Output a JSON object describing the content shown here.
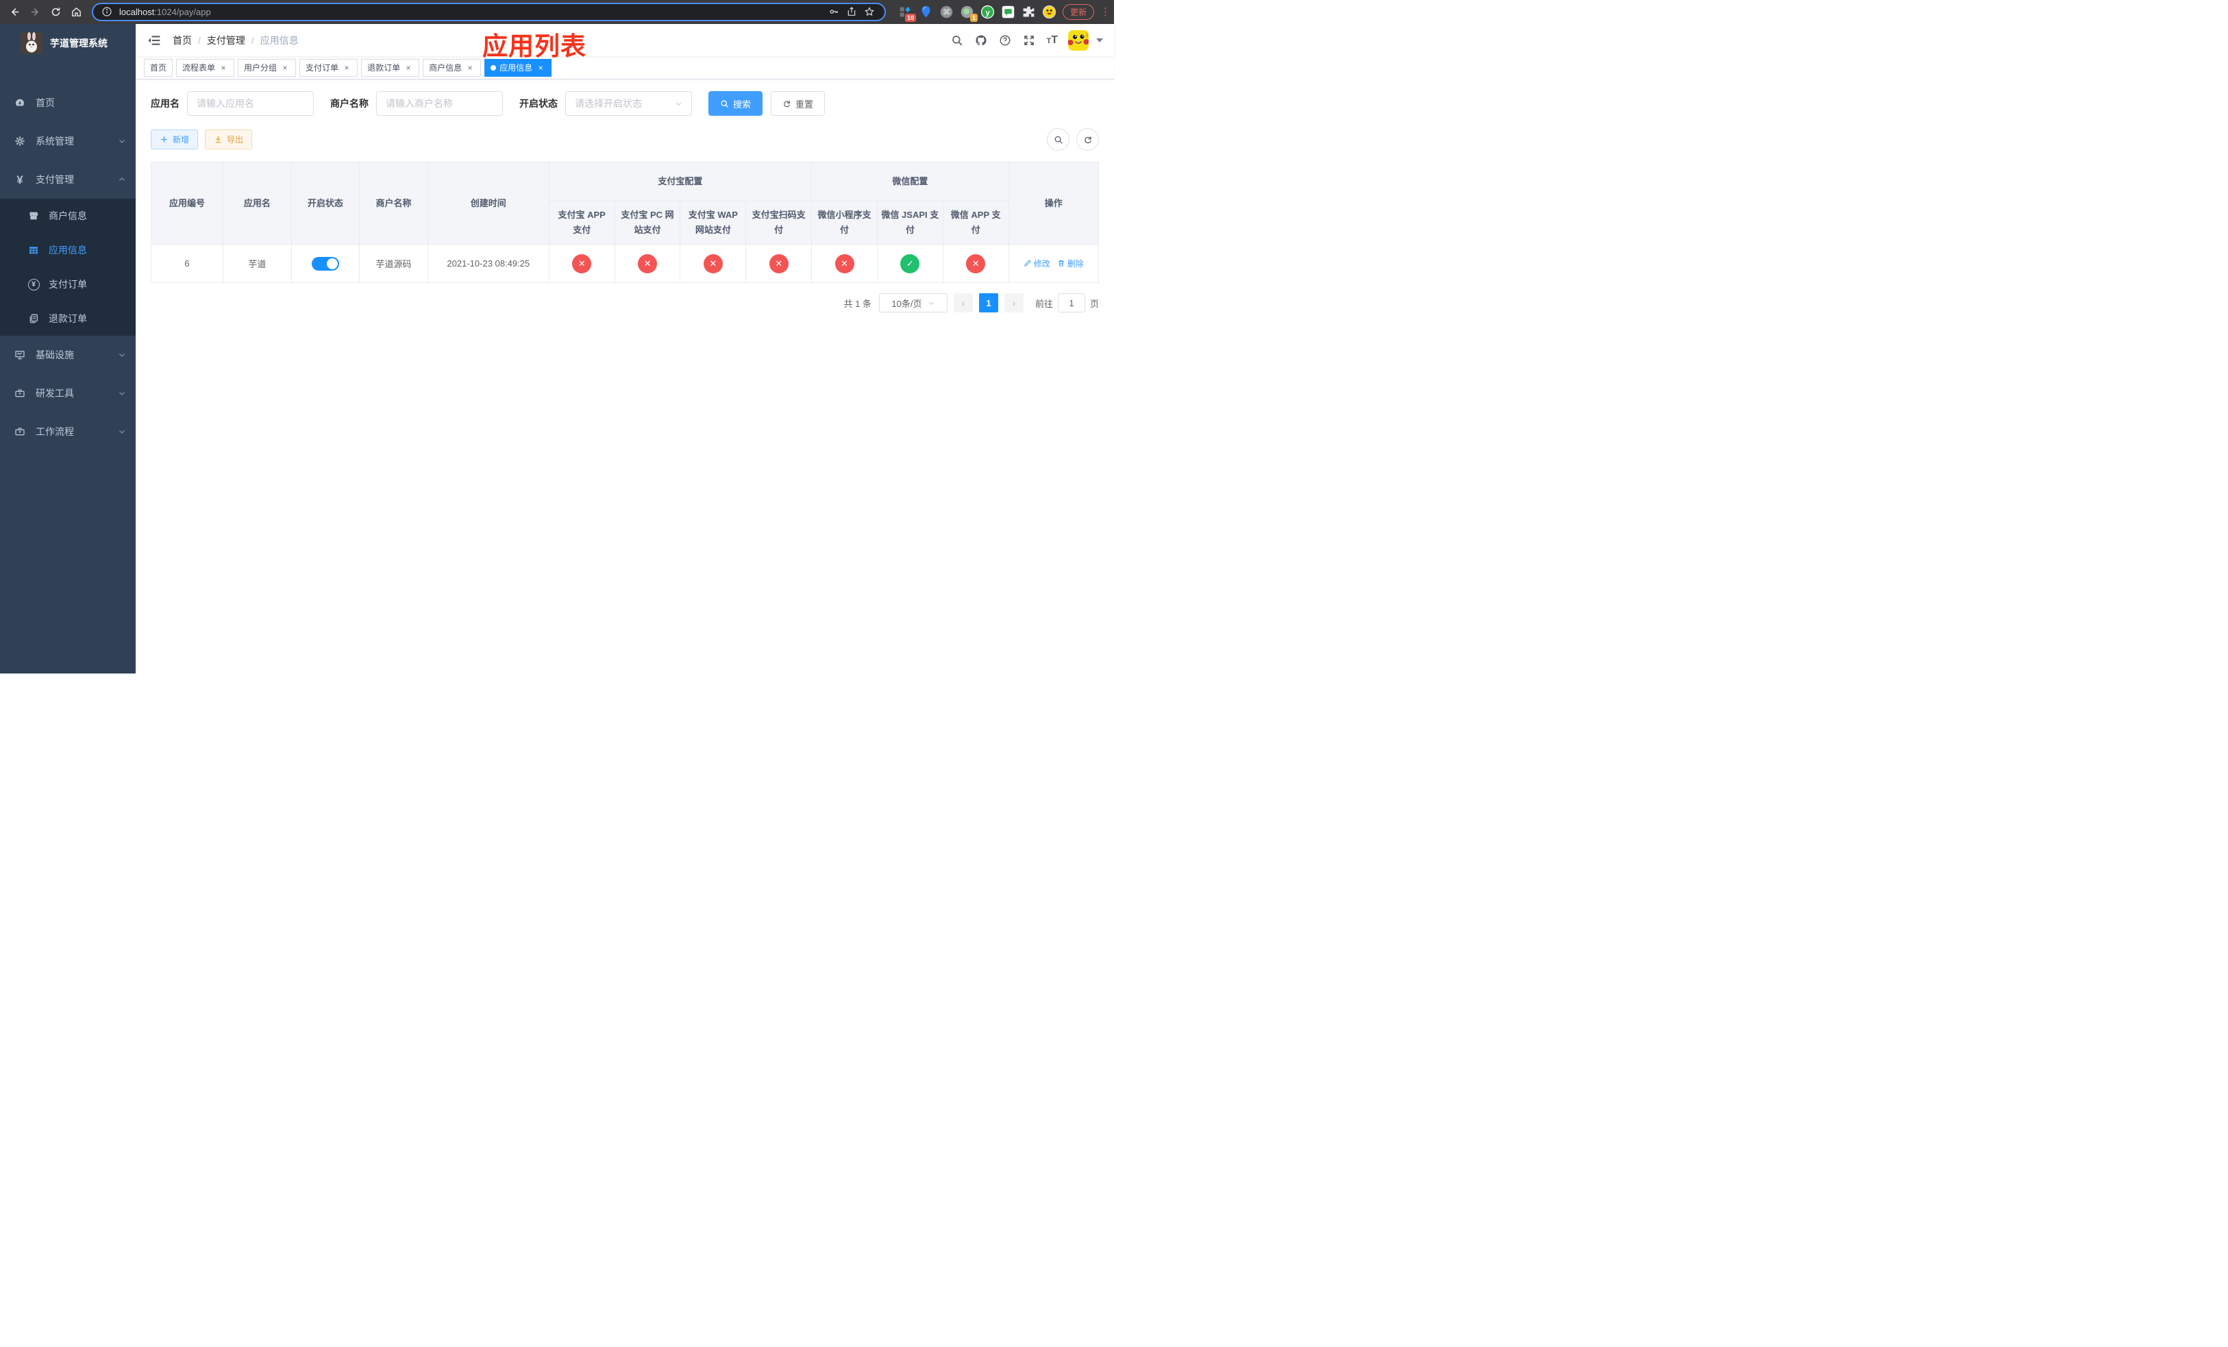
{
  "browser": {
    "url_host": "localhost",
    "url_rest": ":1024/pay/app",
    "update_label": "更新",
    "ext_badge_10": "10",
    "ext_badge_1": "1"
  },
  "sidebar": {
    "title": "芋道管理系统",
    "items": [
      {
        "label": "首页"
      },
      {
        "label": "系统管理"
      },
      {
        "label": "支付管理"
      },
      {
        "label": "商户信息"
      },
      {
        "label": "应用信息"
      },
      {
        "label": "支付订单"
      },
      {
        "label": "退款订单"
      },
      {
        "label": "基础设施"
      },
      {
        "label": "研发工具"
      },
      {
        "label": "工作流程"
      }
    ]
  },
  "breadcrumb": {
    "items": [
      "首页",
      "支付管理",
      "应用信息"
    ]
  },
  "annotation": {
    "title": "应用列表"
  },
  "tabs": {
    "items": [
      {
        "label": "首页"
      },
      {
        "label": "流程表单"
      },
      {
        "label": "用户分组"
      },
      {
        "label": "支付订单"
      },
      {
        "label": "退款订单"
      },
      {
        "label": "商户信息"
      },
      {
        "label": "应用信息"
      }
    ]
  },
  "filters": {
    "app_name_label": "应用名",
    "app_name_placeholder": "请输入应用名",
    "merchant_label": "商户名称",
    "merchant_placeholder": "请输入商户名称",
    "status_label": "开启状态",
    "status_placeholder": "请选择开启状态",
    "search_label": "搜索",
    "reset_label": "重置"
  },
  "toolbar": {
    "add_label": "新增",
    "export_label": "导出"
  },
  "table": {
    "header": {
      "simple": [
        "应用编号",
        "应用名",
        "开启状态",
        "商户名称",
        "创建时间"
      ],
      "alipay_group": "支付宝配置",
      "alipay_children": [
        "支付宝 APP 支付",
        "支付宝 PC 网站支付",
        "支付宝 WAP 网站支付",
        "支付宝扫码支付"
      ],
      "wechat_group": "微信配置",
      "wechat_children": [
        "微信小程序支付",
        "微信 JSAPI 支付",
        "微信 APP 支付"
      ],
      "op": "操作"
    },
    "row": {
      "id": "6",
      "name": "芋道",
      "enabled": true,
      "merchant": "芋道源码",
      "created": "2021-10-23 08:49:25",
      "pay_status": [
        "cross",
        "cross",
        "cross",
        "cross",
        "cross",
        "check",
        "cross"
      ],
      "edit_label": "修改",
      "delete_label": "删除"
    }
  },
  "pagination": {
    "total_label": "共 1 条",
    "page_size": "10条/页",
    "current_page": "1",
    "goto_label": "前往",
    "goto_value": "1",
    "page_label": "页"
  },
  "colors": {
    "accent": "#409eff",
    "tab_active": "#1890ff",
    "success": "#1fc16d",
    "danger": "#f45454",
    "sidebar_bg": "#304156",
    "submenu_bg": "#1f2d3d",
    "annotation_red": "#f5331b"
  }
}
